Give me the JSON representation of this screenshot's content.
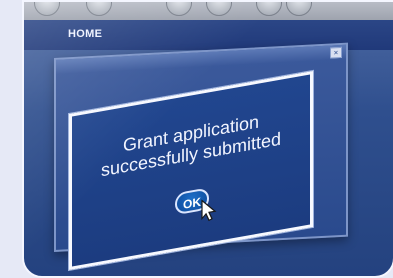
{
  "nav": {
    "home_label": "HOME"
  },
  "dialog": {
    "line1": "Grant application",
    "line2": "successfully submitted",
    "ok_label": "OK"
  },
  "window": {
    "close_glyph": "×"
  },
  "icons": [
    "close-icon",
    "cursor-icon"
  ],
  "colors": {
    "dialog_bg": "#21468f",
    "ok_button": "#0d4a9b",
    "frame_border": "#f4f6ff"
  }
}
